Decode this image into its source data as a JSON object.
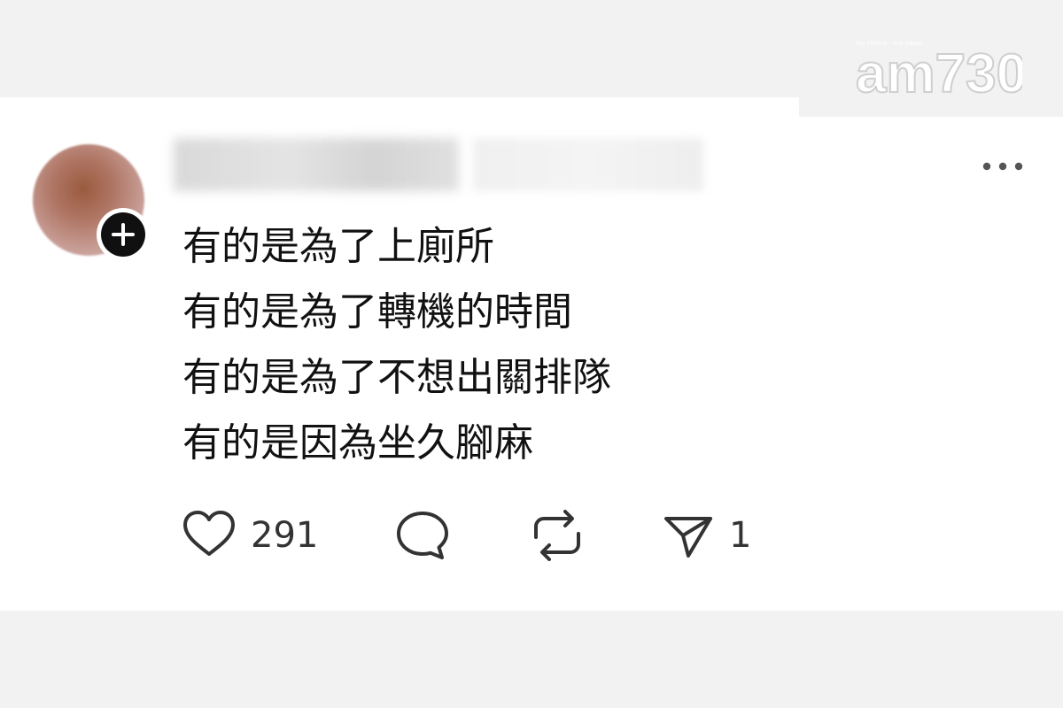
{
  "watermark": {
    "brand": "am730",
    "tagline": "my choice · my paper"
  },
  "post": {
    "lines": [
      "有的是為了上廁所",
      "有的是為了轉機的時間",
      "有的是為了不想出關排隊",
      "有的是因為坐久腳麻"
    ],
    "actions": {
      "like_count": "291",
      "share_count": "1"
    }
  },
  "icons": {
    "follow": "plus-icon",
    "more": "more-horizontal-icon",
    "like": "heart-icon",
    "comment": "comment-bubble-icon",
    "repost": "repost-icon",
    "share": "send-icon"
  },
  "colors": {
    "text": "#111111",
    "icon": "#333333",
    "background": "#ffffff"
  }
}
